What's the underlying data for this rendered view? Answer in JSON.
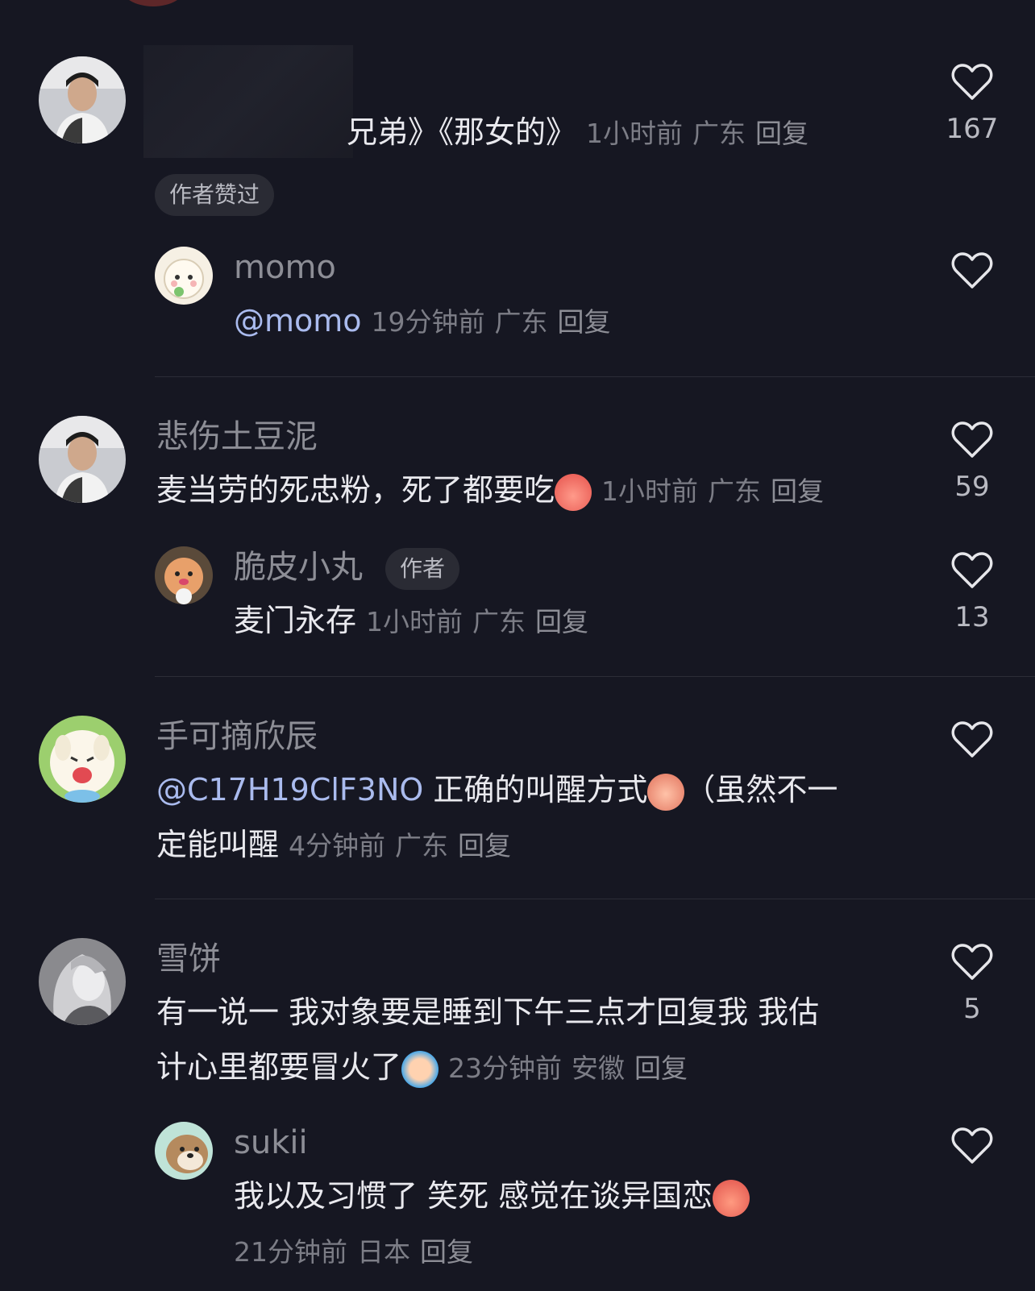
{
  "comments": [
    {
      "id": "c1",
      "text_visible": "兄弟》《那女的》",
      "time": "1小时前",
      "location": "广东",
      "reply": "回复",
      "likes": "167",
      "badge": "作者赞过",
      "replies": [
        {
          "username": "momo",
          "mention": "@momo",
          "time": "19分钟前",
          "location": "广东",
          "reply": "回复"
        }
      ]
    },
    {
      "id": "c2",
      "username": "悲伤土豆泥",
      "text": "麦当劳的死忠粉，死了都要吃",
      "time": "1小时前",
      "location": "广东",
      "reply": "回复",
      "likes": "59",
      "replies": [
        {
          "username": "脆皮小丸",
          "author_badge": "作者",
          "text": "麦门永存",
          "time": "1小时前",
          "location": "广东",
          "reply": "回复",
          "likes": "13"
        }
      ]
    },
    {
      "id": "c3",
      "username": "手可摘欣辰",
      "mention": "@C17H19ClF3NO",
      "text_line1": " 正确的叫醒方式",
      "text_line1_tail": "（虽然不一",
      "text_line2": "定能叫醒",
      "time": "4分钟前",
      "location": "广东",
      "reply": "回复"
    },
    {
      "id": "c4",
      "username": "雪饼",
      "text_line1": "有一说一 我对象要是睡到下午三点才回复我 我估",
      "text_line2": "计心里都要冒火了",
      "time": "23分钟前",
      "location": "安徽",
      "reply": "回复",
      "likes": "5",
      "replies": [
        {
          "username": "sukii",
          "text": "我以及习惯了 笑死 感觉在谈异国恋",
          "time": "21分钟前",
          "location": "日本",
          "reply": "回复"
        }
      ]
    }
  ],
  "icons": {
    "like": "heart-outline-icon",
    "emoji_thumbsup": "thumbs-up-emoji",
    "emoji_pray": "praying-emoji",
    "emoji_cry": "crying-emoji",
    "emoji_hands": "praying-hands-emoji"
  },
  "colors": {
    "background": "#161722",
    "mention": "#aabbee",
    "username": "#8d8e96"
  }
}
